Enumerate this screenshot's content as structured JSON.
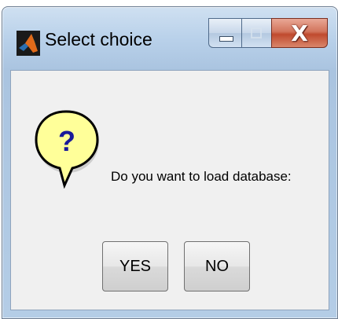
{
  "window": {
    "title": "Select choice",
    "app_icon": "matlab-logo-icon",
    "controls": {
      "minimize_icon": "minimize-icon",
      "maximize_icon": "maximize-icon",
      "close_symbol": "X"
    }
  },
  "dialog": {
    "icon": "question-icon",
    "icon_symbol": "?",
    "message": "Do you want to load database:",
    "buttons": {
      "yes_label": "YES",
      "no_label": "NO"
    }
  },
  "colors": {
    "frame": "#b9d1ea",
    "client_background": "#f0f0f0",
    "question_bubble": "#ffff99",
    "question_mark": "#1a1a9a",
    "close_button": "#c04a2e"
  }
}
